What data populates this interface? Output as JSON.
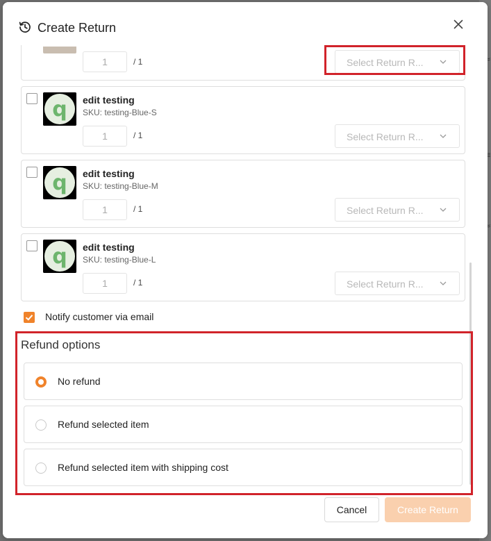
{
  "dialog": {
    "title": "Create Return",
    "icons": {
      "title": "history-icon",
      "close": "close-icon"
    }
  },
  "items": [
    {
      "name": "",
      "sku": "",
      "qty": "1",
      "qty_total": "/ 1",
      "reason_placeholder": "Select Return R..."
    },
    {
      "name": "edit testing",
      "sku": "SKU: testing-Blue-S",
      "qty": "1",
      "qty_total": "/ 1",
      "reason_placeholder": "Select Return R..."
    },
    {
      "name": "edit testing",
      "sku": "SKU: testing-Blue-M",
      "qty": "1",
      "qty_total": "/ 1",
      "reason_placeholder": "Select Return R..."
    },
    {
      "name": "edit testing",
      "sku": "SKU: testing-Blue-L",
      "qty": "1",
      "qty_total": "/ 1",
      "reason_placeholder": "Select Return R..."
    }
  ],
  "notify": {
    "label": "Notify customer via email",
    "checked": true
  },
  "refund": {
    "title": "Refund options",
    "options": [
      {
        "label": "No refund",
        "selected": true
      },
      {
        "label": "Refund selected item",
        "selected": false
      },
      {
        "label": "Refund selected item with shipping cost",
        "selected": false
      }
    ]
  },
  "footer": {
    "cancel_label": "Cancel",
    "create_label": "Create Return"
  },
  "colors": {
    "accent": "#f0832b",
    "accent_disabled": "#fad0ae",
    "highlight": "#d1232a",
    "logo_green": "#6db56d"
  }
}
